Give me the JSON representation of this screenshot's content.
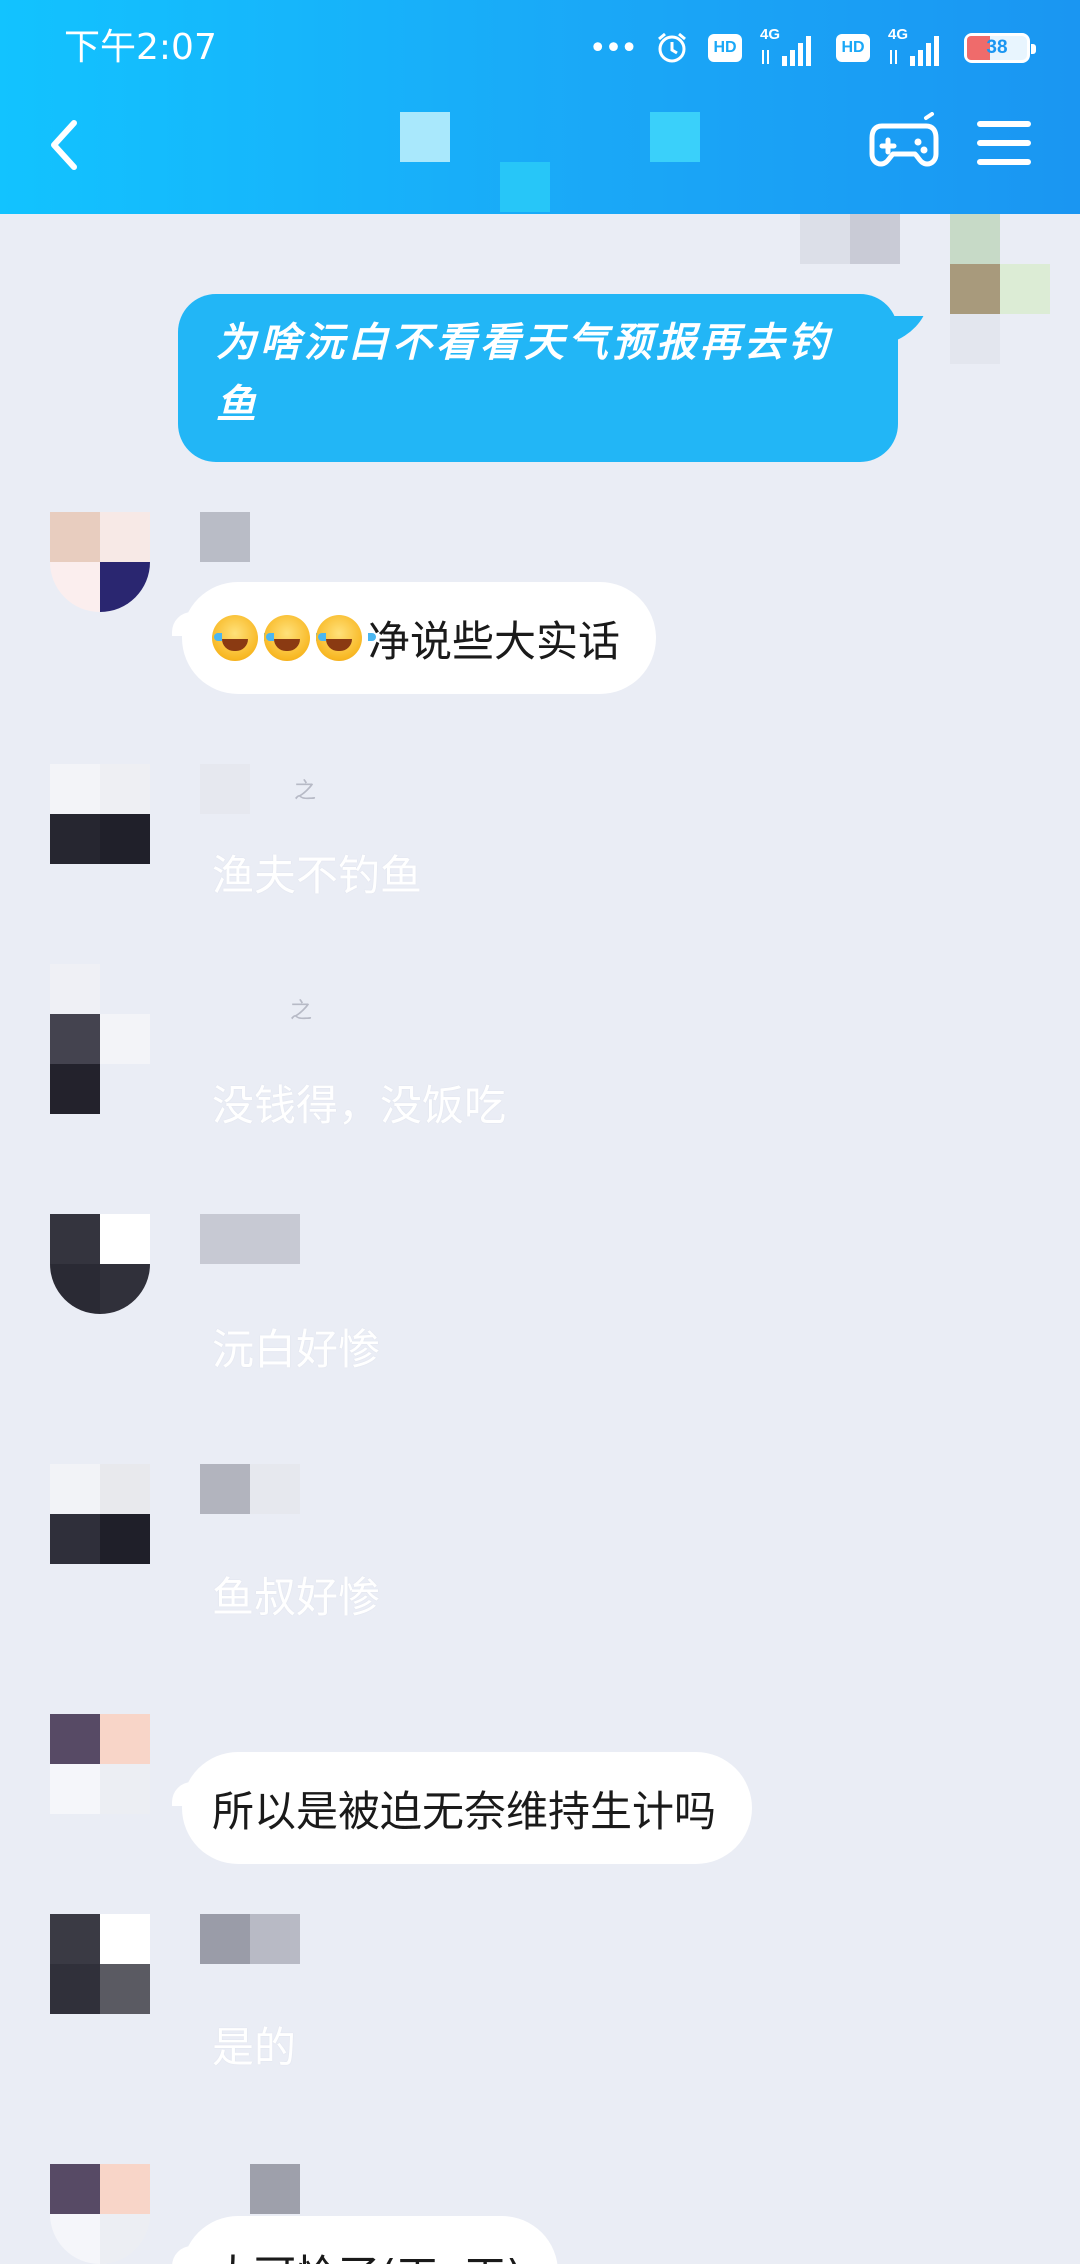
{
  "status_bar": {
    "time": "下午2:07",
    "dots": "•••",
    "hd1": "HD",
    "net1": "4G",
    "hd2": "HD",
    "net2": "4G",
    "battery_level": "38",
    "battery_fraction": 0.38
  },
  "colors": {
    "header_start": "#12c3ff",
    "header_end": "#1a96f2",
    "outgoing_bubble": "#22b6f6",
    "chat_background": "#eaedf5"
  },
  "icons": {
    "back": "chevron-left-icon",
    "game": "gamepad-icon",
    "menu": "hamburger-menu-icon",
    "alarm": "alarm-icon",
    "signal": "signal-icon",
    "battery": "battery-icon",
    "emoji": "tears-of-joy-emoji"
  },
  "messages": {
    "outgoing_1": "为啥沅白不看看天气预报再去钓鱼",
    "m1_text": "净说些大实话",
    "m2_nick_suffix": "之",
    "m2_text": "渔夫不钓鱼",
    "m3_nick_suffix": "之",
    "m3_text": "没钱得，没饭吃",
    "m4_text": "沅白好惨",
    "m5_text": "鱼叔好惨",
    "m6_text": "所以是被迫无奈维持生计吗",
    "m7_text": "是的",
    "m8_text": "太可怜了(ㄒoㄒ)"
  }
}
